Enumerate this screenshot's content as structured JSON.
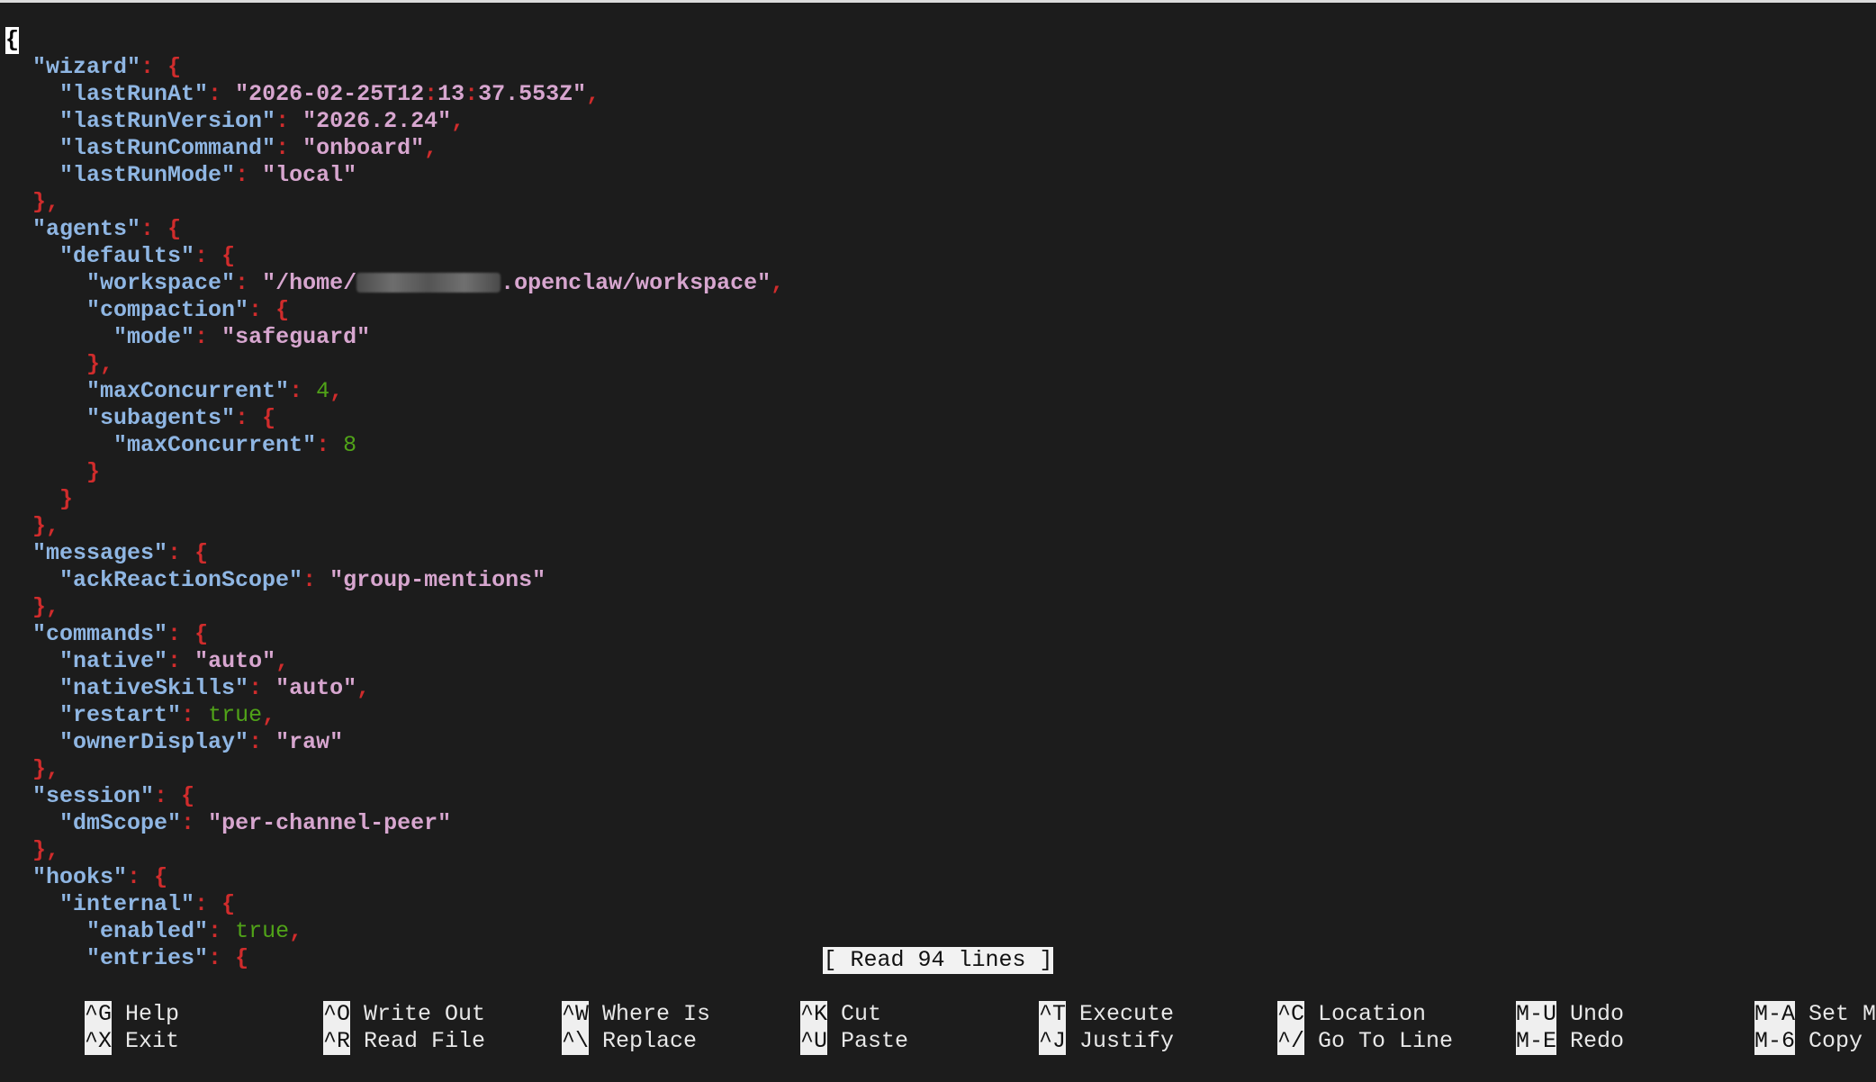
{
  "editor": {
    "lines": [
      [
        {
          "t": "{",
          "c": "cursor"
        }
      ],
      [
        {
          "t": "  "
        },
        {
          "t": "\"wizard\"",
          "c": "key"
        },
        {
          "t": ": ",
          "c": "p"
        },
        {
          "t": "{",
          "c": "p"
        }
      ],
      [
        {
          "t": "    "
        },
        {
          "t": "\"lastRunAt\"",
          "c": "key"
        },
        {
          "t": ": ",
          "c": "p"
        },
        {
          "t": "\"2026-02-25T12",
          "c": "str"
        },
        {
          "t": ":",
          "c": "p"
        },
        {
          "t": "13",
          "c": "str"
        },
        {
          "t": ":",
          "c": "p"
        },
        {
          "t": "37.553Z\"",
          "c": "str"
        },
        {
          "t": ",",
          "c": "p"
        }
      ],
      [
        {
          "t": "    "
        },
        {
          "t": "\"lastRunVersion\"",
          "c": "key"
        },
        {
          "t": ": ",
          "c": "p"
        },
        {
          "t": "\"2026.2.24\"",
          "c": "str"
        },
        {
          "t": ",",
          "c": "p"
        }
      ],
      [
        {
          "t": "    "
        },
        {
          "t": "\"lastRunCommand\"",
          "c": "key"
        },
        {
          "t": ": ",
          "c": "p"
        },
        {
          "t": "\"onboard\"",
          "c": "str"
        },
        {
          "t": ",",
          "c": "p"
        }
      ],
      [
        {
          "t": "    "
        },
        {
          "t": "\"lastRunMode\"",
          "c": "key"
        },
        {
          "t": ": ",
          "c": "p"
        },
        {
          "t": "\"local\"",
          "c": "str"
        }
      ],
      [
        {
          "t": "  "
        },
        {
          "t": "},",
          "c": "p"
        }
      ],
      [
        {
          "t": "  "
        },
        {
          "t": "\"agents\"",
          "c": "key"
        },
        {
          "t": ": ",
          "c": "p"
        },
        {
          "t": "{",
          "c": "p"
        }
      ],
      [
        {
          "t": "    "
        },
        {
          "t": "\"defaults\"",
          "c": "key"
        },
        {
          "t": ": ",
          "c": "p"
        },
        {
          "t": "{",
          "c": "p"
        }
      ],
      [
        {
          "t": "      "
        },
        {
          "t": "\"workspace\"",
          "c": "key"
        },
        {
          "t": ": ",
          "c": "p"
        },
        {
          "t": "\"/home/",
          "c": "str"
        },
        {
          "t": "",
          "c": "redacted"
        },
        {
          "t": ".openclaw/workspace\"",
          "c": "str"
        },
        {
          "t": ",",
          "c": "p"
        }
      ],
      [
        {
          "t": "      "
        },
        {
          "t": "\"compaction\"",
          "c": "key"
        },
        {
          "t": ": ",
          "c": "p"
        },
        {
          "t": "{",
          "c": "p"
        }
      ],
      [
        {
          "t": "        "
        },
        {
          "t": "\"mode\"",
          "c": "key"
        },
        {
          "t": ": ",
          "c": "p"
        },
        {
          "t": "\"safeguard\"",
          "c": "str"
        }
      ],
      [
        {
          "t": "      "
        },
        {
          "t": "},",
          "c": "p"
        }
      ],
      [
        {
          "t": "      "
        },
        {
          "t": "\"maxConcurrent\"",
          "c": "key"
        },
        {
          "t": ": ",
          "c": "p"
        },
        {
          "t": "4",
          "c": "lit"
        },
        {
          "t": ",",
          "c": "p"
        }
      ],
      [
        {
          "t": "      "
        },
        {
          "t": "\"subagents\"",
          "c": "key"
        },
        {
          "t": ": ",
          "c": "p"
        },
        {
          "t": "{",
          "c": "p"
        }
      ],
      [
        {
          "t": "        "
        },
        {
          "t": "\"maxConcurrent\"",
          "c": "key"
        },
        {
          "t": ": ",
          "c": "p"
        },
        {
          "t": "8",
          "c": "lit"
        }
      ],
      [
        {
          "t": "      "
        },
        {
          "t": "}",
          "c": "p"
        }
      ],
      [
        {
          "t": "    "
        },
        {
          "t": "}",
          "c": "p"
        }
      ],
      [
        {
          "t": "  "
        },
        {
          "t": "},",
          "c": "p"
        }
      ],
      [
        {
          "t": "  "
        },
        {
          "t": "\"messages\"",
          "c": "key"
        },
        {
          "t": ": ",
          "c": "p"
        },
        {
          "t": "{",
          "c": "p"
        }
      ],
      [
        {
          "t": "    "
        },
        {
          "t": "\"ackReactionScope\"",
          "c": "key"
        },
        {
          "t": ": ",
          "c": "p"
        },
        {
          "t": "\"group-mentions\"",
          "c": "str"
        }
      ],
      [
        {
          "t": "  "
        },
        {
          "t": "},",
          "c": "p"
        }
      ],
      [
        {
          "t": "  "
        },
        {
          "t": "\"commands\"",
          "c": "key"
        },
        {
          "t": ": ",
          "c": "p"
        },
        {
          "t": "{",
          "c": "p"
        }
      ],
      [
        {
          "t": "    "
        },
        {
          "t": "\"native\"",
          "c": "key"
        },
        {
          "t": ": ",
          "c": "p"
        },
        {
          "t": "\"auto\"",
          "c": "str"
        },
        {
          "t": ",",
          "c": "p"
        }
      ],
      [
        {
          "t": "    "
        },
        {
          "t": "\"nativeSkills\"",
          "c": "key"
        },
        {
          "t": ": ",
          "c": "p"
        },
        {
          "t": "\"auto\"",
          "c": "str"
        },
        {
          "t": ",",
          "c": "p"
        }
      ],
      [
        {
          "t": "    "
        },
        {
          "t": "\"restart\"",
          "c": "key"
        },
        {
          "t": ": ",
          "c": "p"
        },
        {
          "t": "true",
          "c": "lit"
        },
        {
          "t": ",",
          "c": "p"
        }
      ],
      [
        {
          "t": "    "
        },
        {
          "t": "\"ownerDisplay\"",
          "c": "key"
        },
        {
          "t": ": ",
          "c": "p"
        },
        {
          "t": "\"raw\"",
          "c": "str"
        }
      ],
      [
        {
          "t": "  "
        },
        {
          "t": "},",
          "c": "p"
        }
      ],
      [
        {
          "t": "  "
        },
        {
          "t": "\"session\"",
          "c": "key"
        },
        {
          "t": ": ",
          "c": "p"
        },
        {
          "t": "{",
          "c": "p"
        }
      ],
      [
        {
          "t": "    "
        },
        {
          "t": "\"dmScope\"",
          "c": "key"
        },
        {
          "t": ": ",
          "c": "p"
        },
        {
          "t": "\"per-channel-peer\"",
          "c": "str"
        }
      ],
      [
        {
          "t": "  "
        },
        {
          "t": "},",
          "c": "p"
        }
      ],
      [
        {
          "t": "  "
        },
        {
          "t": "\"hooks\"",
          "c": "key"
        },
        {
          "t": ": ",
          "c": "p"
        },
        {
          "t": "{",
          "c": "p"
        }
      ],
      [
        {
          "t": "    "
        },
        {
          "t": "\"internal\"",
          "c": "key"
        },
        {
          "t": ": ",
          "c": "p"
        },
        {
          "t": "{",
          "c": "p"
        }
      ],
      [
        {
          "t": "      "
        },
        {
          "t": "\"enabled\"",
          "c": "key"
        },
        {
          "t": ": ",
          "c": "p"
        },
        {
          "t": "true",
          "c": "lit"
        },
        {
          "t": ",",
          "c": "p"
        }
      ],
      [
        {
          "t": "      "
        },
        {
          "t": "\"entries\"",
          "c": "key"
        },
        {
          "t": ": ",
          "c": "p"
        },
        {
          "t": "{",
          "c": "p"
        }
      ]
    ]
  },
  "status": {
    "message": "[ Read 94 lines ]"
  },
  "shortcuts": [
    {
      "key": "^G",
      "label": "Help"
    },
    {
      "key": "^X",
      "label": "Exit"
    },
    {
      "key": "^O",
      "label": "Write Out"
    },
    {
      "key": "^R",
      "label": "Read File"
    },
    {
      "key": "^W",
      "label": "Where Is"
    },
    {
      "key": "^\\",
      "label": "Replace"
    },
    {
      "key": "^K",
      "label": "Cut"
    },
    {
      "key": "^U",
      "label": "Paste"
    },
    {
      "key": "^T",
      "label": "Execute"
    },
    {
      "key": "^J",
      "label": "Justify"
    },
    {
      "key": "^C",
      "label": "Location"
    },
    {
      "key": "^/",
      "label": "Go To Line"
    },
    {
      "key": "M-U",
      "label": "Undo"
    },
    {
      "key": "M-E",
      "label": "Redo"
    },
    {
      "key": "M-A",
      "label": "Set Mark"
    },
    {
      "key": "M-6",
      "label": "Copy"
    }
  ],
  "colors": {
    "background": "#1c1c1c",
    "key": "#8fb6e3",
    "string": "#d7a6cf",
    "literal": "#50a318",
    "punctuation": "#d02c2c"
  }
}
